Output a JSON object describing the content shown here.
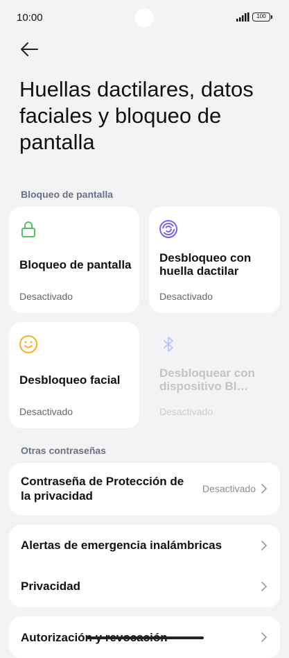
{
  "status_bar": {
    "time": "10:00",
    "battery": "100"
  },
  "page": {
    "title": "Huellas dactilares, datos faciales y bloqueo de pantalla"
  },
  "sections": {
    "screen_lock": "Bloqueo de pantalla",
    "other_passwords": "Otras contraseñas"
  },
  "tiles": [
    {
      "name": "Bloqueo de pantalla",
      "status": "Desactivado",
      "icon": "lock-icon",
      "color": "#4cc466"
    },
    {
      "name": "Desbloqueo con huella dactilar",
      "status": "Desactivado",
      "icon": "fingerprint-icon",
      "color": "#7b5cf5"
    },
    {
      "name": "Desbloqueo facial",
      "status": "Desactivado",
      "icon": "face-icon",
      "color": "#f2b321"
    },
    {
      "name": "Desbloquear con dispositivo Bl…",
      "status": "Desactivado",
      "icon": "bluetooth-icon",
      "color": "#b9c6ff",
      "disabled": true
    }
  ],
  "privacy_password": {
    "label": "Contraseña de Protección de la privacidad",
    "value": "Desactivado"
  },
  "list": {
    "emergency_alerts": "Alertas de emergencia inalámbricas",
    "privacy": "Privacidad",
    "authorization": "Autorización y revocación"
  }
}
